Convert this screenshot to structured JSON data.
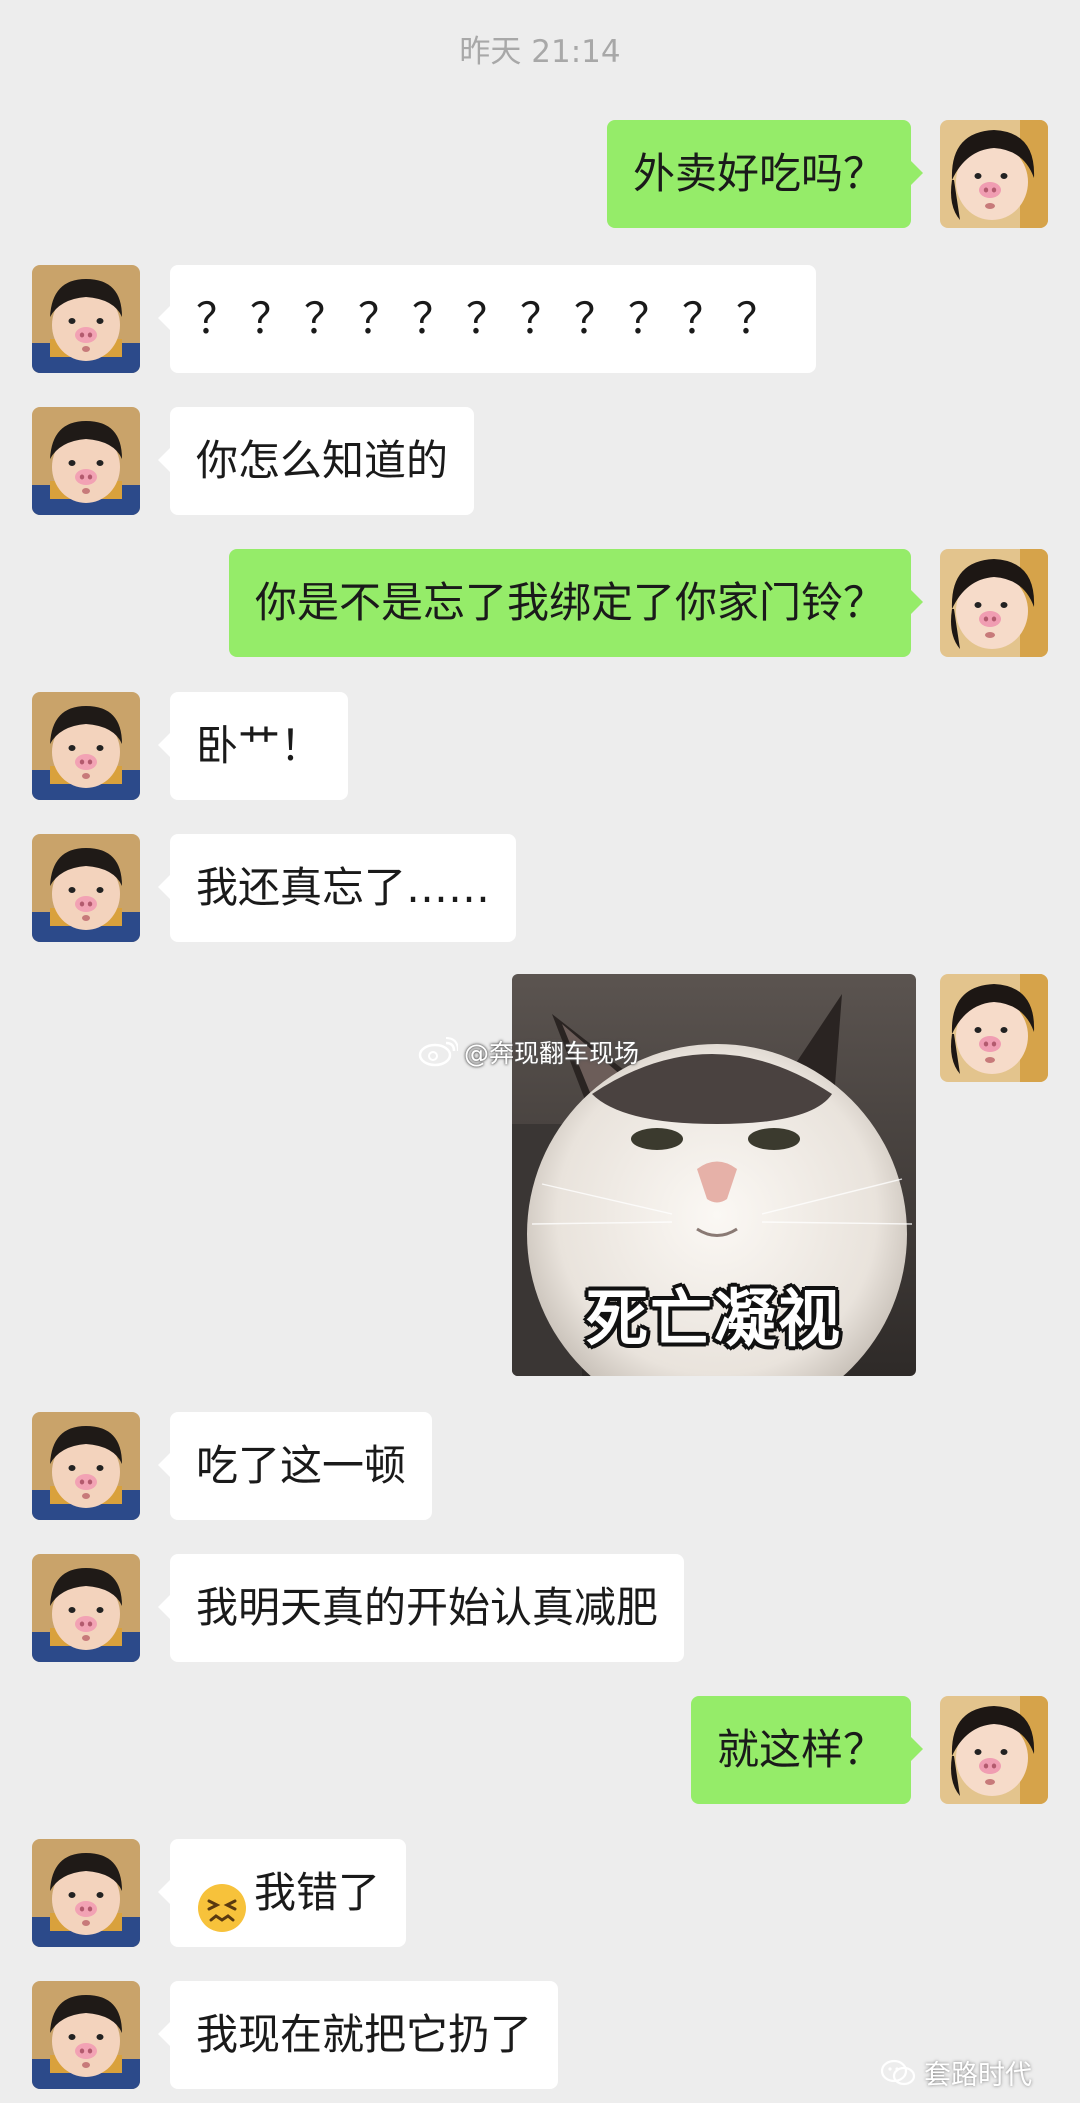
{
  "timestamp": "昨天 21:14",
  "messages": [
    {
      "side": "out",
      "text": "外卖好吃吗？"
    },
    {
      "side": "in",
      "text": "？？？？？？？？？？？"
    },
    {
      "side": "in",
      "text": "你怎么知道的"
    },
    {
      "side": "out",
      "text": "你是不是忘了我绑定了你家门铃？"
    },
    {
      "side": "in",
      "text": "卧艹！"
    },
    {
      "side": "in",
      "text": "我还真忘了……"
    },
    {
      "side": "out",
      "type": "sticker",
      "caption": "死亡凝视"
    },
    {
      "side": "in",
      "text": "吃了这一顿"
    },
    {
      "side": "in",
      "text": "我明天真的开始认真减肥"
    },
    {
      "side": "out",
      "text": "就这样？"
    },
    {
      "side": "in",
      "emoji": "confounded-face-icon",
      "text": "我错了"
    },
    {
      "side": "in",
      "text": "我现在就把它扔了"
    }
  ],
  "watermarks": {
    "weibo": "@奔现翻车现场",
    "wechat": "套路时代"
  },
  "colors": {
    "background": "#ededed",
    "incoming_bubble": "#ffffff",
    "outgoing_bubble": "#95ec69",
    "timestamp_text": "#a8a8a8"
  }
}
